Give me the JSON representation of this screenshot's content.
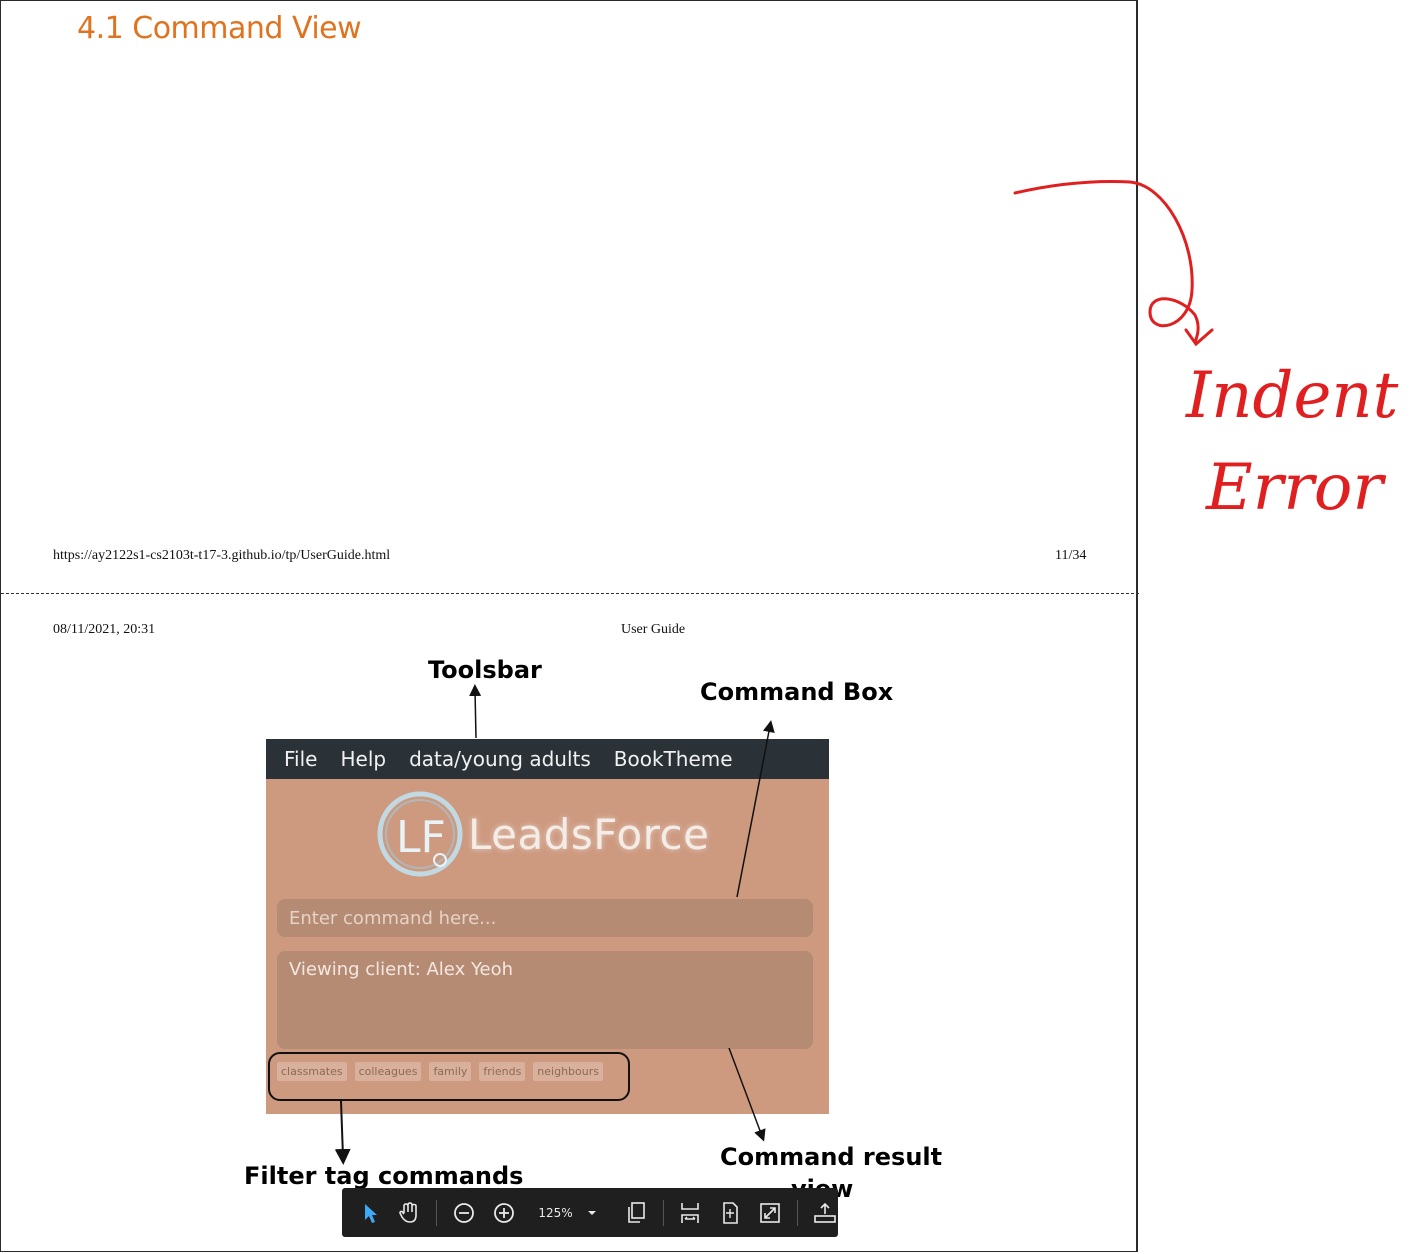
{
  "document": {
    "section_title": "4.1 Command View",
    "footer_url": "https://ay2122s1-cs2103t-t17-3.github.io/tp/UserGuide.html",
    "footer_page": "11/34",
    "header_date": "08/11/2021, 20:31",
    "header_title": "User Guide"
  },
  "annotations": {
    "toolsbar": "Toolsbar",
    "command_box": "Command Box",
    "filter_tags": "Filter tag commands",
    "command_result_line1": "Command  result",
    "command_result_line2": "view"
  },
  "handwritten_note": {
    "line1": "Indent",
    "line2": "Error",
    "color": "#e02020"
  },
  "app": {
    "menu": [
      "File",
      "Help",
      "data/young adults",
      "BookTheme"
    ],
    "brand_name": "LeadsForce",
    "logo_letters": "LF",
    "command_placeholder": "Enter command here...",
    "result_text": "Viewing client: Alex Yeoh",
    "tags": [
      "classmates",
      "colleagues",
      "family",
      "friends",
      "neighbours"
    ],
    "colors": {
      "menubar": "#2a3137",
      "background": "#cd9a80",
      "box": "#b68b73"
    }
  },
  "viewer_toolbar": {
    "zoom_level": "125%",
    "tools": [
      "pointer-icon",
      "hand-icon",
      "zoom-out-icon",
      "zoom-in-icon",
      "zoom-dropdown",
      "copy-pages-icon",
      "fit-width-icon",
      "fit-page-icon",
      "fullscreen-icon",
      "upload-icon"
    ]
  }
}
